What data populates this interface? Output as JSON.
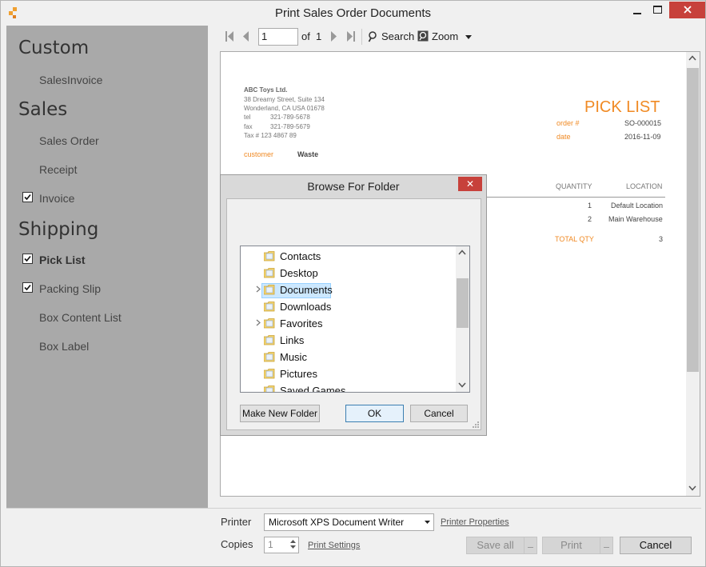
{
  "window": {
    "title": "Print Sales Order Documents"
  },
  "sidebar": {
    "sections": [
      {
        "title": "Custom",
        "items": [
          {
            "label": "SalesInvoice",
            "checked": false
          }
        ]
      },
      {
        "title": "Sales",
        "items": [
          {
            "label": "Sales Order",
            "checked": false
          },
          {
            "label": "Receipt",
            "checked": false
          },
          {
            "label": "Invoice",
            "checked": true
          }
        ]
      },
      {
        "title": "Shipping",
        "items": [
          {
            "label": "Pick List",
            "checked": true,
            "active": true
          },
          {
            "label": "Packing Slip",
            "checked": true
          },
          {
            "label": "Box Content List",
            "checked": false
          },
          {
            "label": "Box Label",
            "checked": false
          }
        ]
      }
    ]
  },
  "toolbar": {
    "page_value": "1",
    "of_label": "of",
    "total_pages": "1",
    "search_label": "Search",
    "zoom_label": "Zoom"
  },
  "document": {
    "company_name": "ABC Toys Ltd.",
    "address_line1": "38 Dreamy Street, Suite 134",
    "address_line2": "Wonderland, CA USA 01678",
    "tel_label": "tel",
    "tel_value": "321-789-5678",
    "fax_label": "fax",
    "fax_value": "321-789-5679",
    "tax_line": "Tax # 123 4867 89",
    "title": "PICK LIST",
    "order_label": "order #",
    "order_value": "SO-000015",
    "date_label": "date",
    "date_value": "2016-11-09",
    "customer_label": "customer",
    "customer_value": "Waste",
    "table_headers": {
      "quantity": "QUANTITY",
      "location": "LOCATION"
    },
    "rows": [
      {
        "quantity": "1",
        "location": "Default Location"
      },
      {
        "quantity": "2",
        "location": "Main Warehouse"
      }
    ],
    "total_label": "TOTAL QTY",
    "total_value": "3"
  },
  "dialog": {
    "title": "Browse For Folder",
    "close_label": "✕",
    "folders": [
      {
        "name": "Contacts",
        "expandable": false,
        "selected": false
      },
      {
        "name": "Desktop",
        "expandable": false,
        "selected": false
      },
      {
        "name": "Documents",
        "expandable": true,
        "selected": true
      },
      {
        "name": "Downloads",
        "expandable": false,
        "selected": false
      },
      {
        "name": "Favorites",
        "expandable": true,
        "selected": false
      },
      {
        "name": "Links",
        "expandable": false,
        "selected": false
      },
      {
        "name": "Music",
        "expandable": false,
        "selected": false
      },
      {
        "name": "Pictures",
        "expandable": false,
        "selected": false
      },
      {
        "name": "Saved Games",
        "expandable": false,
        "selected": false
      }
    ],
    "make_folder_label": "Make New Folder",
    "ok_label": "OK",
    "cancel_label": "Cancel"
  },
  "footer": {
    "printer_label": "Printer",
    "printer_value": "Microsoft XPS Document Writer",
    "printer_properties_label": "Printer Properties",
    "copies_label": "Copies",
    "copies_value": "1",
    "print_settings_label": "Print Settings",
    "save_all_label": "Save all",
    "print_label": "Print",
    "cancel_label": "Cancel"
  },
  "colors": {
    "accent_orange": "#f08a24",
    "close_red": "#c7413b",
    "sidebar_bg": "#a9a9a9",
    "selection_blue": "#cce8ff"
  }
}
